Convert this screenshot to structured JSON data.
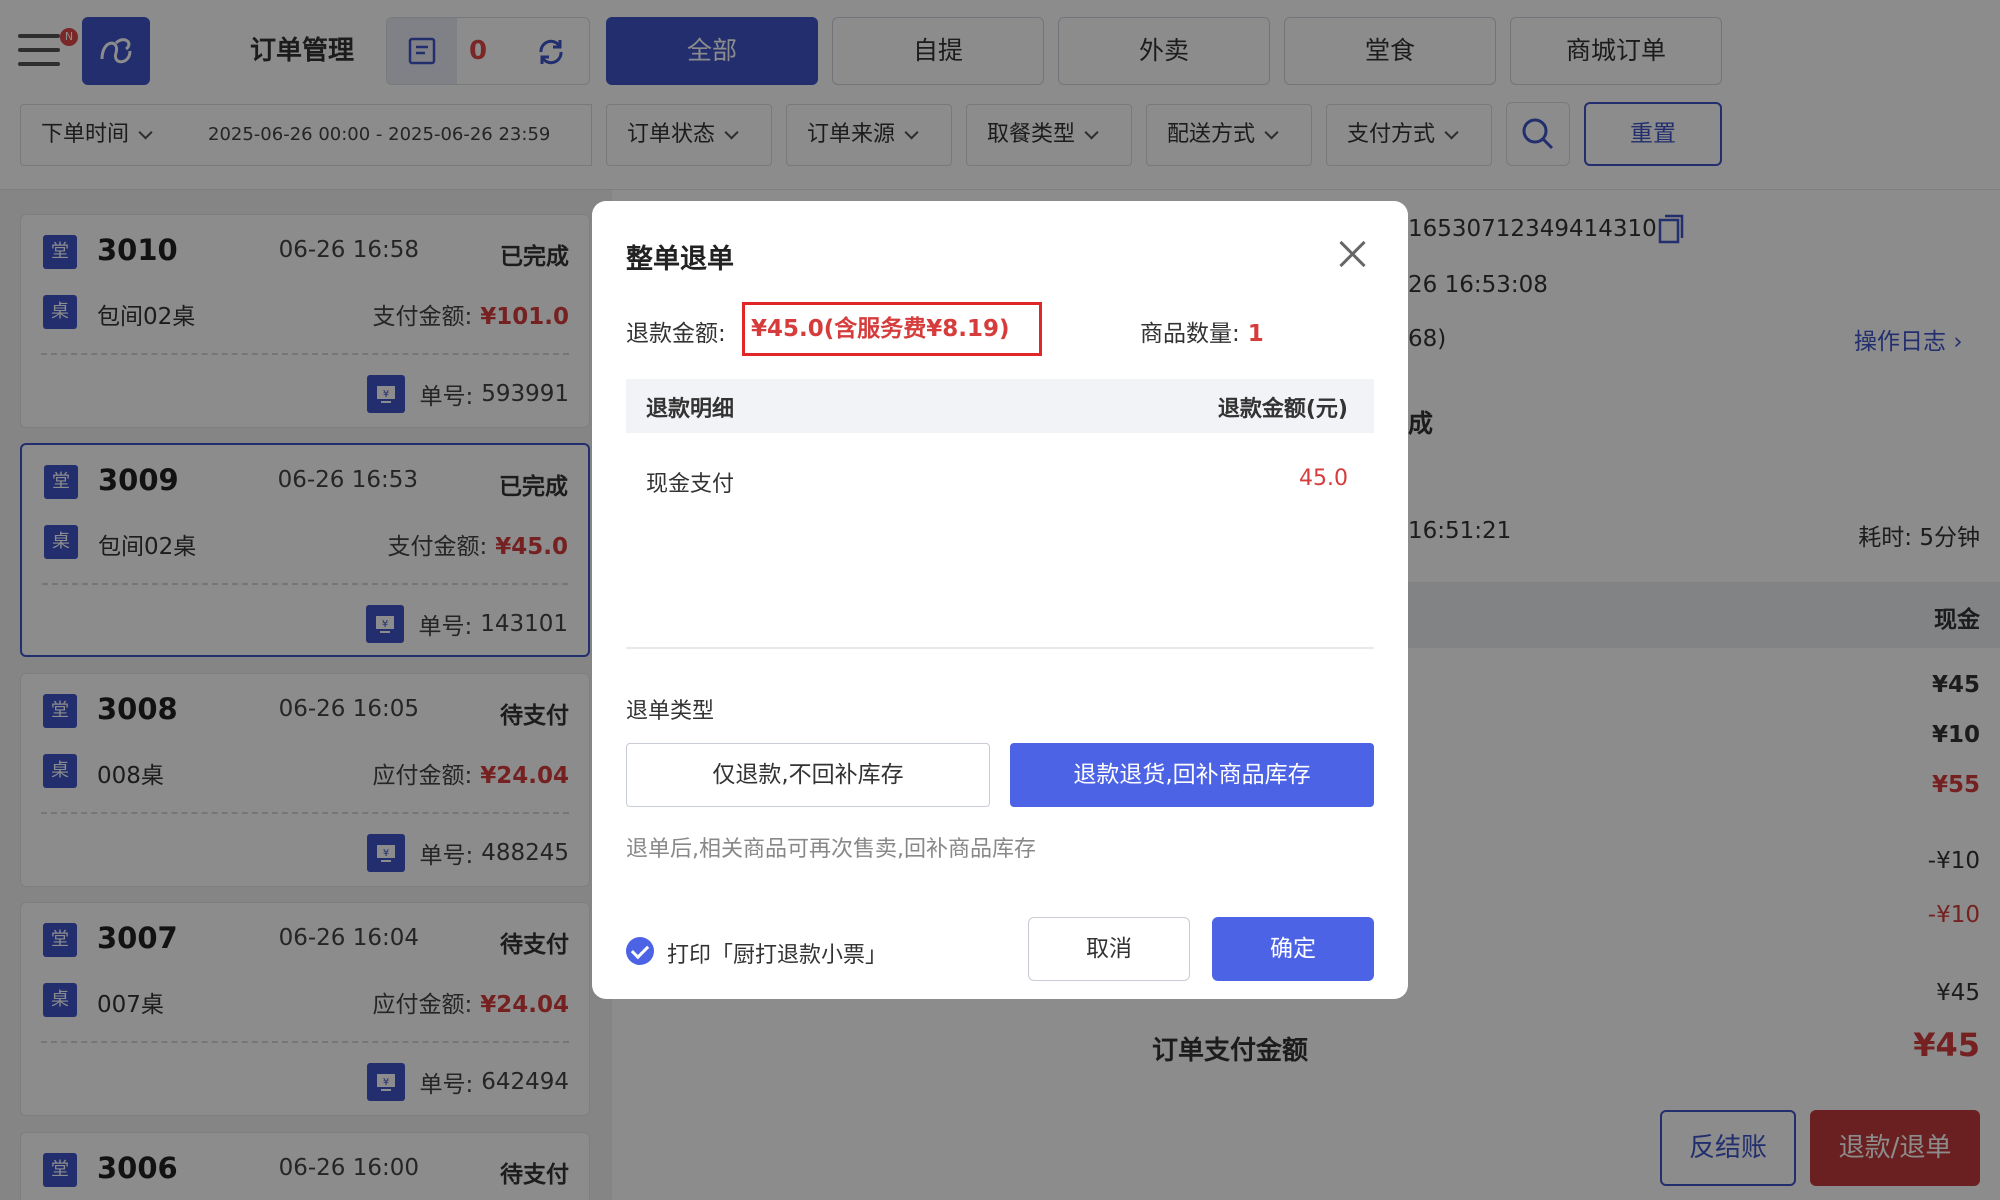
{
  "header": {
    "menu_badge": "N",
    "title": "订单管理",
    "notice_count": "0",
    "type_tabs": [
      "全部",
      "自提",
      "外卖",
      "堂食",
      "商城订单"
    ]
  },
  "filters": {
    "order_time": "下单时间",
    "date_range": "2025-06-26 00:00 - 2025-06-26 23:59",
    "order_status": "订单状态",
    "order_source": "订单来源",
    "pickup_type": "取餐类型",
    "delivery_method": "配送方式",
    "payment_method": "支付方式",
    "reset": "重置"
  },
  "orders": [
    {
      "tag1": "堂",
      "tag2": "桌",
      "no": "3010",
      "time": "06-26 16:58",
      "status": "已完成",
      "table": "包间02桌",
      "pay_label": "支付金额:",
      "amount": "¥101.0",
      "serial_label": "单号:",
      "serial": "593991"
    },
    {
      "tag1": "堂",
      "tag2": "桌",
      "no": "3009",
      "time": "06-26 16:53",
      "status": "已完成",
      "table": "包间02桌",
      "pay_label": "支付金额:",
      "amount": "¥45.0",
      "serial_label": "单号:",
      "serial": "143101"
    },
    {
      "tag1": "堂",
      "tag2": "桌",
      "no": "3008",
      "time": "06-26 16:05",
      "status": "待支付",
      "table": "008桌",
      "pay_label": "应付金额:",
      "amount": "¥24.04",
      "serial_label": "单号:",
      "serial": "488245"
    },
    {
      "tag1": "堂",
      "tag2": "桌",
      "no": "3007",
      "time": "06-26 16:04",
      "status": "待支付",
      "table": "007桌",
      "pay_label": "应付金额:",
      "amount": "¥24.04",
      "serial_label": "单号:",
      "serial": "642494"
    },
    {
      "tag1": "堂",
      "no": "3006",
      "time": "06-26 16:00",
      "status": "待支付"
    }
  ],
  "detail": {
    "order_id": "16530712349414310",
    "created": "26 16:53:08",
    "partial_code": "68)",
    "op_log": "操作日志",
    "status_partial": "成",
    "paid_time": "16:51:21",
    "duration": "耗时: 5分钟",
    "pay_method": "现金",
    "v1": "¥45",
    "v2": "¥10",
    "v3": "¥55",
    "v4": "-¥10",
    "v5": "-¥10",
    "v6": "¥45",
    "total_label": "订单支付金额",
    "total": "¥45",
    "anti_checkout": "反结账",
    "refund": "退款/退单"
  },
  "modal": {
    "title": "整单退单",
    "amount_label": "退款金额:",
    "amount": "¥45.0(含服务费¥8.19)",
    "qty_label": "商品数量:",
    "qty": "1",
    "col_detail": "退款明细",
    "col_amount": "退款金额(元)",
    "row_method": "现金支付",
    "row_amount": "45.0",
    "type_label": "退单类型",
    "opt_refund_only": "仅退款,不回补库存",
    "opt_refund_return": "退款退货,回补商品库存",
    "hint": "退单后,相关商品可再次售卖,回补商品库存",
    "print_label": "打印「厨打退款小票」",
    "cancel": "取消",
    "confirm": "确定"
  },
  "colors": {
    "primary": "#3e55c8",
    "button_blue": "#4d63e6",
    "price_red": "#d63c3c",
    "highlight_border": "#e02626"
  }
}
